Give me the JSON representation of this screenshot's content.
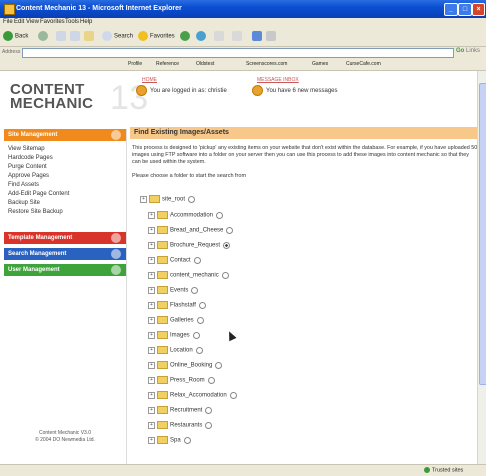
{
  "window": {
    "title": "Content Mechanic 13 - Microsoft Internet Explorer"
  },
  "menu": [
    "File",
    "Edit",
    "View",
    "Favorites",
    "Tools",
    "Help"
  ],
  "toolbar": {
    "back": "Back",
    "search": "Search",
    "favorites": "Favorites"
  },
  "address": {
    "label": "Address",
    "go": "Go",
    "links": "Links"
  },
  "links": [
    "Profile",
    "Reference",
    "Oldstest",
    "Screenscores.com",
    "Games",
    "CurseCafe.com"
  ],
  "logo": {
    "line1": "CONTENT",
    "line2": "MECHANIC",
    "mark": "13"
  },
  "header": {
    "home_link": "HOME",
    "messages_link": "MESSAGE INBOX",
    "logged_in": "You are logged in as: christie",
    "messages": "You have 6 new messages"
  },
  "sidebar": {
    "site_management": "Site Management",
    "items": [
      "View Sitemap",
      "Hardcode Pages",
      "Purge Content",
      "Approve Pages",
      "Find Assets",
      "Add-Edit Page Content",
      "Backup Site",
      "Restore Site Backup"
    ],
    "template_management": "Template Management",
    "search_management": "Search Management",
    "user_management": "User Management",
    "footer_line1": "Content Mechanic V3.0",
    "footer_line2": "© 2004 DO Newmedia Ltd."
  },
  "main": {
    "title": "Find Existing Images/Assets",
    "intro": "This process is designed to 'pickup' any existing items on your website that don't exist within the database. For example, if you have uploaded 50 images using FTP software into a folder on your server then you can use this process to add these images into content mechanic so that they can be used within the system.",
    "prompt": "Please choose a folder to start the search from",
    "root": "site_root",
    "folders": [
      "Accommodation",
      "Bread_and_Cheese",
      "Brochure_Request",
      "Contact",
      "content_mechanic",
      "Events",
      "Flashstaff",
      "Galleries",
      "Images",
      "Location",
      "Online_Booking",
      "Press_Room",
      "Relax_Accomodation",
      "Recruitment",
      "Restaurants",
      "Spa"
    ]
  },
  "status": {
    "zone": "Trusted sites"
  },
  "colors": {
    "site_management": "#f08a1c",
    "template_management": "#d9342b",
    "search_management": "#2a62c0",
    "user_management": "#3ea33b",
    "title_bg": "#f8c88a"
  }
}
